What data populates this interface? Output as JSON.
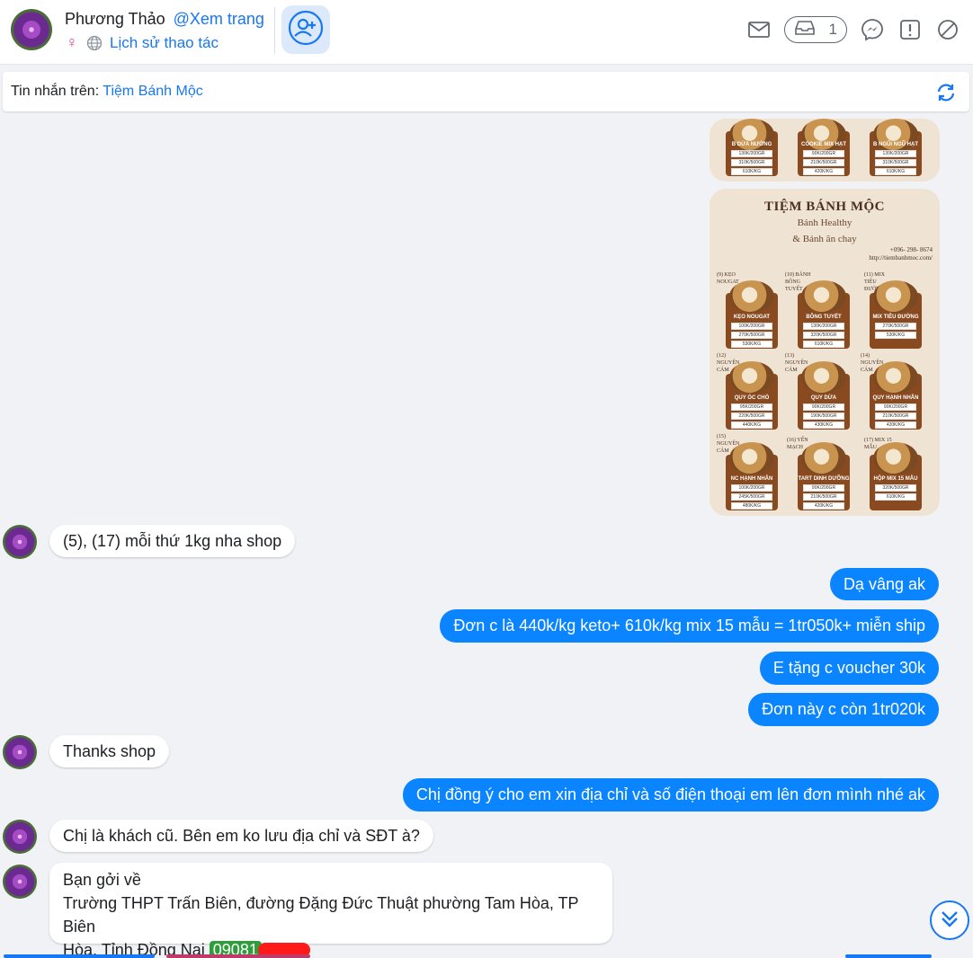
{
  "header": {
    "name": "Phương Thảo",
    "view_page": "@Xem trang",
    "gender_symbol": "♀",
    "history": "Lịch sử thao tác",
    "inbox_count": "1"
  },
  "pagebar": {
    "prefix": "Tin nhắn trên: ",
    "page_name": "Tiệm Bánh Mộc"
  },
  "menu_image_top": {
    "cards": [
      {
        "name": "B DỪA NƯỚNG",
        "lines": [
          "130K/200GR",
          "310K/500GR",
          "610K/KG"
        ]
      },
      {
        "name": "COOKIE MIX HẠT",
        "lines": [
          "90K/200GR",
          "210K/500GR",
          "420K/KG"
        ]
      },
      {
        "name": "B NGŨI NGŨ HẠT",
        "lines": [
          "130K/200GR",
          "310K/500GR",
          "610K/KG"
        ]
      }
    ]
  },
  "menu_image_main": {
    "title": "TIỆM BÁNH MỘC",
    "sub1": "Bánh Healthy",
    "sub2": "& Bánh ăn chay",
    "phone": "+096- 298- 8674",
    "url": "http://tiembanhmoc.com/",
    "cards": [
      {
        "num": "(9) KẸO NOUGAT",
        "name": "KẸO NOUGAT",
        "lines": [
          "100K/200GR",
          "270K/500GR",
          "530K/KG"
        ]
      },
      {
        "num": "(10) BÁNH BÔNG TUYẾT",
        "name": "BÔNG TUYẾT",
        "lines": [
          "130K/200GR",
          "320K/500GR",
          "610K/KG"
        ]
      },
      {
        "num": "(11) MIX TIÊU ĐƯỜNG",
        "name": "MIX TIÊU ĐƯỜNG",
        "lines": [
          "270K/500GR",
          "530K/KG"
        ]
      },
      {
        "num": "(12) NGUYÊN CÁM",
        "name": "QUY ÓC CHÓ",
        "lines": [
          "95K/200GR",
          "220K/500GR",
          "440K/KG"
        ]
      },
      {
        "num": "(13) NGUYÊN CÁM",
        "name": "QUY DỪA",
        "lines": [
          "90K/200GR",
          "190K/500GR",
          "430K/KG"
        ]
      },
      {
        "num": "(14) NGUYÊN CÁM",
        "name": "QUY HẠNH NHÂN",
        "lines": [
          "90K/200GR",
          "210K/500GR",
          "420K/KG"
        ]
      },
      {
        "num": "(15) NGUYÊN CÁM",
        "name": "NC HẠNH NHÂN",
        "lines": [
          "100K/200GR",
          "245K/500GR",
          "480K/KG"
        ]
      },
      {
        "num": "(16) YẾN MẠCH",
        "name": "TART DINH DƯỠNG",
        "lines": [
          "90K/200GR",
          "210K/500GR",
          "420K/KG"
        ]
      },
      {
        "num": "(17) MIX 15 MẪU",
        "name": "HỘP MIX 15 MẪU",
        "lines": [
          "320K/500GR",
          "610K/KG"
        ]
      }
    ]
  },
  "messages": [
    {
      "dir": "in",
      "text": "(5), (17) mỗi thứ 1kg nha shop"
    },
    {
      "dir": "out",
      "text": "Dạ vâng ak"
    },
    {
      "dir": "out",
      "text": "Đơn c là 440k/kg keto+ 610k/kg mix 15 mẫu = 1tr050k+ miễn ship"
    },
    {
      "dir": "out",
      "text": "E tặng c voucher 30k"
    },
    {
      "dir": "out",
      "text": "Đơn này c còn 1tr020k"
    },
    {
      "dir": "in",
      "text": "Thanks shop"
    },
    {
      "dir": "out",
      "text": "Chị đồng ý cho em xin địa chỉ và số điện thoại em lên đơn mình nhé ak"
    },
    {
      "dir": "in",
      "text": "Chị là khách cũ. Bên em ko lưu địa chỉ và SĐT à?"
    },
    {
      "dir": "in",
      "line1": "Bạn gởi về",
      "line2": "Trường THPT Trấn Biên, đường Đặng Đức Thuật phường Tam Hòa, TP Biên",
      "line3": "Hòa, Tỉnh Đồng Nai",
      "phone": "09081"
    }
  ],
  "colors": {
    "accent": "#1877f2",
    "outgoing_bubble": "#0a84ff",
    "background": "#f0f2f5",
    "phone_highlight": "#2e9e3a",
    "redaction": "#ff1a1a"
  },
  "icons": [
    "add-friend-icon",
    "mail-icon",
    "inbox-icon",
    "messenger-icon",
    "report-icon",
    "block-icon",
    "refresh-icon",
    "scroll-down-icon",
    "globe-icon"
  ]
}
